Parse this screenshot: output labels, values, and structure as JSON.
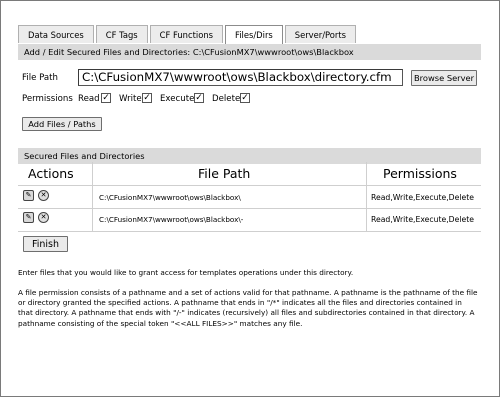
{
  "tabs": [
    {
      "label": "Data Sources"
    },
    {
      "label": "CF Tags"
    },
    {
      "label": "CF Functions"
    },
    {
      "label": "Files/Dirs"
    },
    {
      "label": "Server/Ports"
    }
  ],
  "edit_section": {
    "title": "Add / Edit Secured Files and Directories: C:\\CFusionMX7\\wwwroot\\ows\\Blackbox",
    "file_path_label": "File Path",
    "file_path_value": "C:\\CFusionMX7\\wwwroot\\ows\\Blackbox\\directory.cfm",
    "browse_button": "Browse Server",
    "permissions_label": "Permissions",
    "permissions": [
      {
        "label": "Read",
        "checked": "✓"
      },
      {
        "label": "Write",
        "checked": "✓"
      },
      {
        "label": "Execute",
        "checked": "✓"
      },
      {
        "label": "Delete",
        "checked": "✓"
      }
    ],
    "add_button": "Add Files / Paths"
  },
  "secured_section": {
    "title": "Secured Files and Directories",
    "columns": {
      "actions": "Actions",
      "file_path": "File Path",
      "permissions": "Permissions"
    },
    "rows": [
      {
        "path": "C:\\CFusionMX7\\wwwroot\\ows\\Blackbox\\",
        "permissions": "Read,Write,Execute,Delete"
      },
      {
        "path": "C:\\CFusionMX7\\wwwroot\\ows\\Blackbox\\-",
        "permissions": "Read,Write,Execute,Delete"
      }
    ],
    "finish_button": "Finish"
  },
  "help": {
    "intro": "Enter files that you would like to grant access for templates operations under this directory.",
    "details": "A file permission consists of a pathname and a set of actions valid for that pathname. A pathname is the pathname of the file or directory granted the specified actions. A pathname that ends in \"/*\" indicates all the files and directories contained in that directory. A pathname that ends with \"/-\" indicates (recursively) all files and subdirectories contained in that directory. A pathname consisting of the special token \"<<ALL FILES>>\" matches any file."
  }
}
